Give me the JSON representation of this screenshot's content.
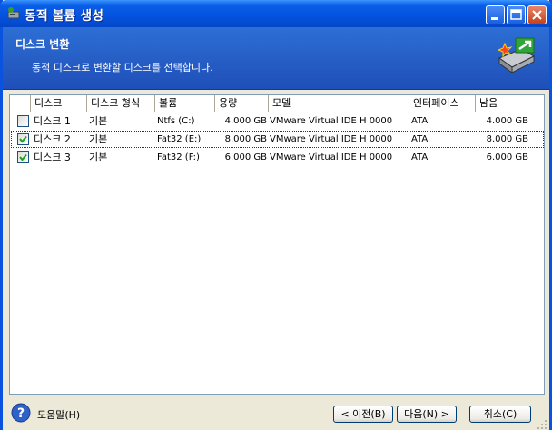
{
  "window": {
    "title": "동적 볼륨 생성"
  },
  "header": {
    "title": "디스크 변환",
    "description": "동적 디스크로 변환할 디스크를 선택합니다."
  },
  "table": {
    "columns": [
      "디스크",
      "디스크 형식",
      "볼륨",
      "용량",
      "모델",
      "인터페이스",
      "남음"
    ],
    "rows": [
      {
        "checked": false,
        "disk": "디스크 1",
        "type": "기본",
        "volume": "Ntfs (C:)",
        "capacity": "4.000 GB",
        "model": "VMware Virtual IDE H 0000",
        "interface": "ATA",
        "free": "4.000 GB"
      },
      {
        "checked": true,
        "disk": "디스크 2",
        "type": "기본",
        "volume": "Fat32 (E:)",
        "capacity": "8.000 GB",
        "model": "VMware Virtual IDE H 0000",
        "interface": "ATA",
        "free": "8.000 GB"
      },
      {
        "checked": true,
        "disk": "디스크 3",
        "type": "기본",
        "volume": "Fat32 (F:)",
        "capacity": "6.000 GB",
        "model": "VMware Virtual IDE H 0000",
        "interface": "ATA",
        "free": "6.000 GB"
      }
    ]
  },
  "footer": {
    "help_label": "도움말(H)",
    "prev_label": "< 이전(B)",
    "next_label": "다음(N) >",
    "cancel_label": "취소(C)"
  },
  "colors": {
    "titlebar": "#0553E1",
    "header": "#2D6FD5",
    "dialog_bg": "#ECE9D8"
  },
  "icons": {
    "app": "disk-app-icon",
    "header": "disk-conversion-icon",
    "help": "help-icon"
  }
}
